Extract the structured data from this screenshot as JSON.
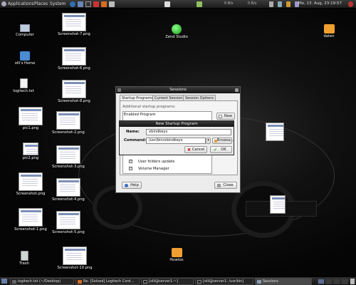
{
  "top_panel": {
    "menus": [
      "Applications",
      "Places",
      "System"
    ],
    "net_down": "0 B/s",
    "net_up": "0 B/s",
    "clock": "Mo, 13. Aug, 23:19:57"
  },
  "desktop": {
    "icons": [
      {
        "label": "Computer"
      },
      {
        "label": "olli's Home"
      },
      {
        "label": "logitech.txt"
      },
      {
        "label": "pic1.png"
      },
      {
        "label": "pic2.png"
      },
      {
        "label": "Screenshot.png"
      },
      {
        "label": "Screenshot-1.png"
      },
      {
        "label": "Trash"
      },
      {
        "label": "Screenshot-7.png"
      },
      {
        "label": "Screenshot-6.png"
      },
      {
        "label": "Screenshot-8.png"
      },
      {
        "label": "Screenshot-2.png"
      },
      {
        "label": "Screenshot-3.png"
      },
      {
        "label": "Screenshot-4.png"
      },
      {
        "label": "Screenshot-5.png"
      },
      {
        "label": "Screenshot-10.png"
      },
      {
        "label": "Zend Studio"
      },
      {
        "label": "daten"
      },
      {
        "label": "Howtos"
      }
    ]
  },
  "sessions": {
    "title": "Sessions",
    "tabs": [
      "Startup Programs",
      "Current Session",
      "Session Options"
    ],
    "section_label": "Additional startup programs:",
    "list_header": "Enabled  Program",
    "new_label": "New",
    "items": [
      "User folders update",
      "Volume Manager"
    ],
    "help_label": "Help",
    "close_label": "Close"
  },
  "new_startup": {
    "title": "New Startup Program",
    "name_label": "Name:",
    "name_value": "xbindkeys",
    "command_label": "Command:",
    "command_value": "/usr/bin/xbindkeys",
    "browse_label": "Browse...",
    "cancel_label": "Cancel",
    "ok_label": "OK"
  },
  "taskbar": {
    "tasks": [
      "logitech.txt (~/Desktop)",
      "Re: [Solved] Logitech Cord...",
      "[olli@server1:~]",
      "[olli@server1: /usr/bin]",
      "Sessions"
    ]
  }
}
